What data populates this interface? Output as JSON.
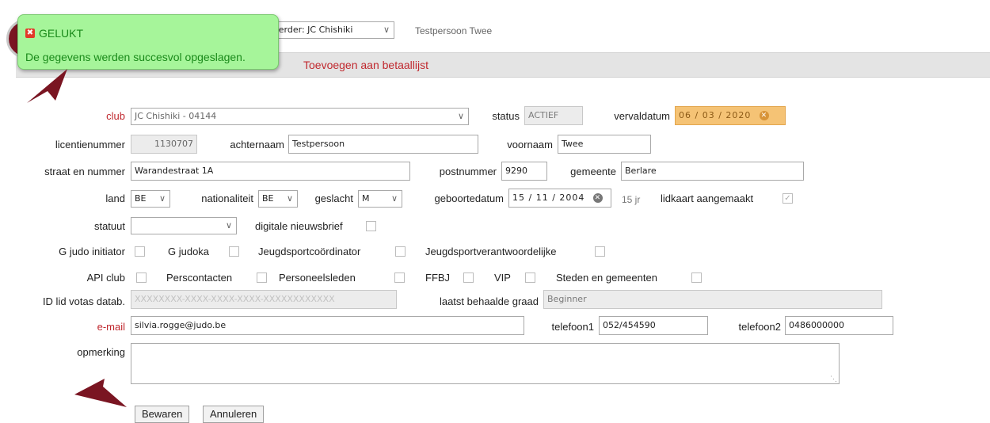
{
  "header": {
    "behandelaar_label": "eerder:",
    "behandelaar_value": "JC Chishiki",
    "person_name": "Testpersoon Twee"
  },
  "action_bar": {
    "add_to_paylist": "Toevoegen aan betaallijst"
  },
  "toast": {
    "title": "GELUKT",
    "message": "De gegevens werden succesvol opgeslagen."
  },
  "form": {
    "club_label": "club",
    "club_value": "JC Chishiki - 04144",
    "status_label": "status",
    "status_value": "ACTIEF",
    "vervaldatum_label": "vervaldatum",
    "vervaldatum_value": "06 / 03 / 2020",
    "licentienummer_label": "licentienummer",
    "licentienummer_value": "1130707",
    "achternaam_label": "achternaam",
    "achternaam_value": "Testpersoon",
    "voornaam_label": "voornaam",
    "voornaam_value": "Twee",
    "straat_label": "straat en nummer",
    "straat_value": "Warandestraat 1A",
    "postnummer_label": "postnummer",
    "postnummer_value": "9290",
    "gemeente_label": "gemeente",
    "gemeente_value": "Berlare",
    "land_label": "land",
    "land_value": "BE",
    "nationaliteit_label": "nationaliteit",
    "nationaliteit_value": "BE",
    "geslacht_label": "geslacht",
    "geslacht_value": "M",
    "geboortedatum_label": "geboortedatum",
    "geboortedatum_value": "15 / 11 / 2004",
    "age_value": "15 jr",
    "lidkaart_label": "lidkaart aangemaakt",
    "statuut_label": "statuut",
    "statuut_value": "",
    "nieuwsbrief_label": "digitale nieuwsbrief",
    "g_judo_initiator_label": "G judo initiator",
    "g_judoka_label": "G judoka",
    "jeugdsportcoordinator_label": "Jeugdsportcoördinator",
    "jeugdsportverantwoordelijke_label": "Jeugdsportverantwoordelijke",
    "api_club_label": "API club",
    "perscontacten_label": "Perscontacten",
    "personeelsleden_label": "Personeelsleden",
    "ffbj_label": "FFBJ",
    "vip_label": "VIP",
    "steden_label": "Steden en gemeenten",
    "id_votas_label": "ID lid votas datab.",
    "id_votas_placeholder": "XXXXXXXX-XXXX-XXXX-XXXX-XXXXXXXXXXXX",
    "graad_label": "laatst behaalde graad",
    "graad_value": "Beginner",
    "email_label": "e-mail",
    "email_value": "silvia.rogge@judo.be",
    "telefoon1_label": "telefoon1",
    "telefoon1_value": "052/454590",
    "telefoon2_label": "telefoon2",
    "telefoon2_value": "0486000000",
    "opmerking_label": "opmerking",
    "opmerking_value": ""
  },
  "buttons": {
    "save": "Bewaren",
    "cancel": "Annuleren"
  },
  "colors": {
    "toast_bg": "#a6f59a",
    "arrow": "#7a1522",
    "label_red": "#c0282e",
    "date_highlight": "#f5c375"
  }
}
